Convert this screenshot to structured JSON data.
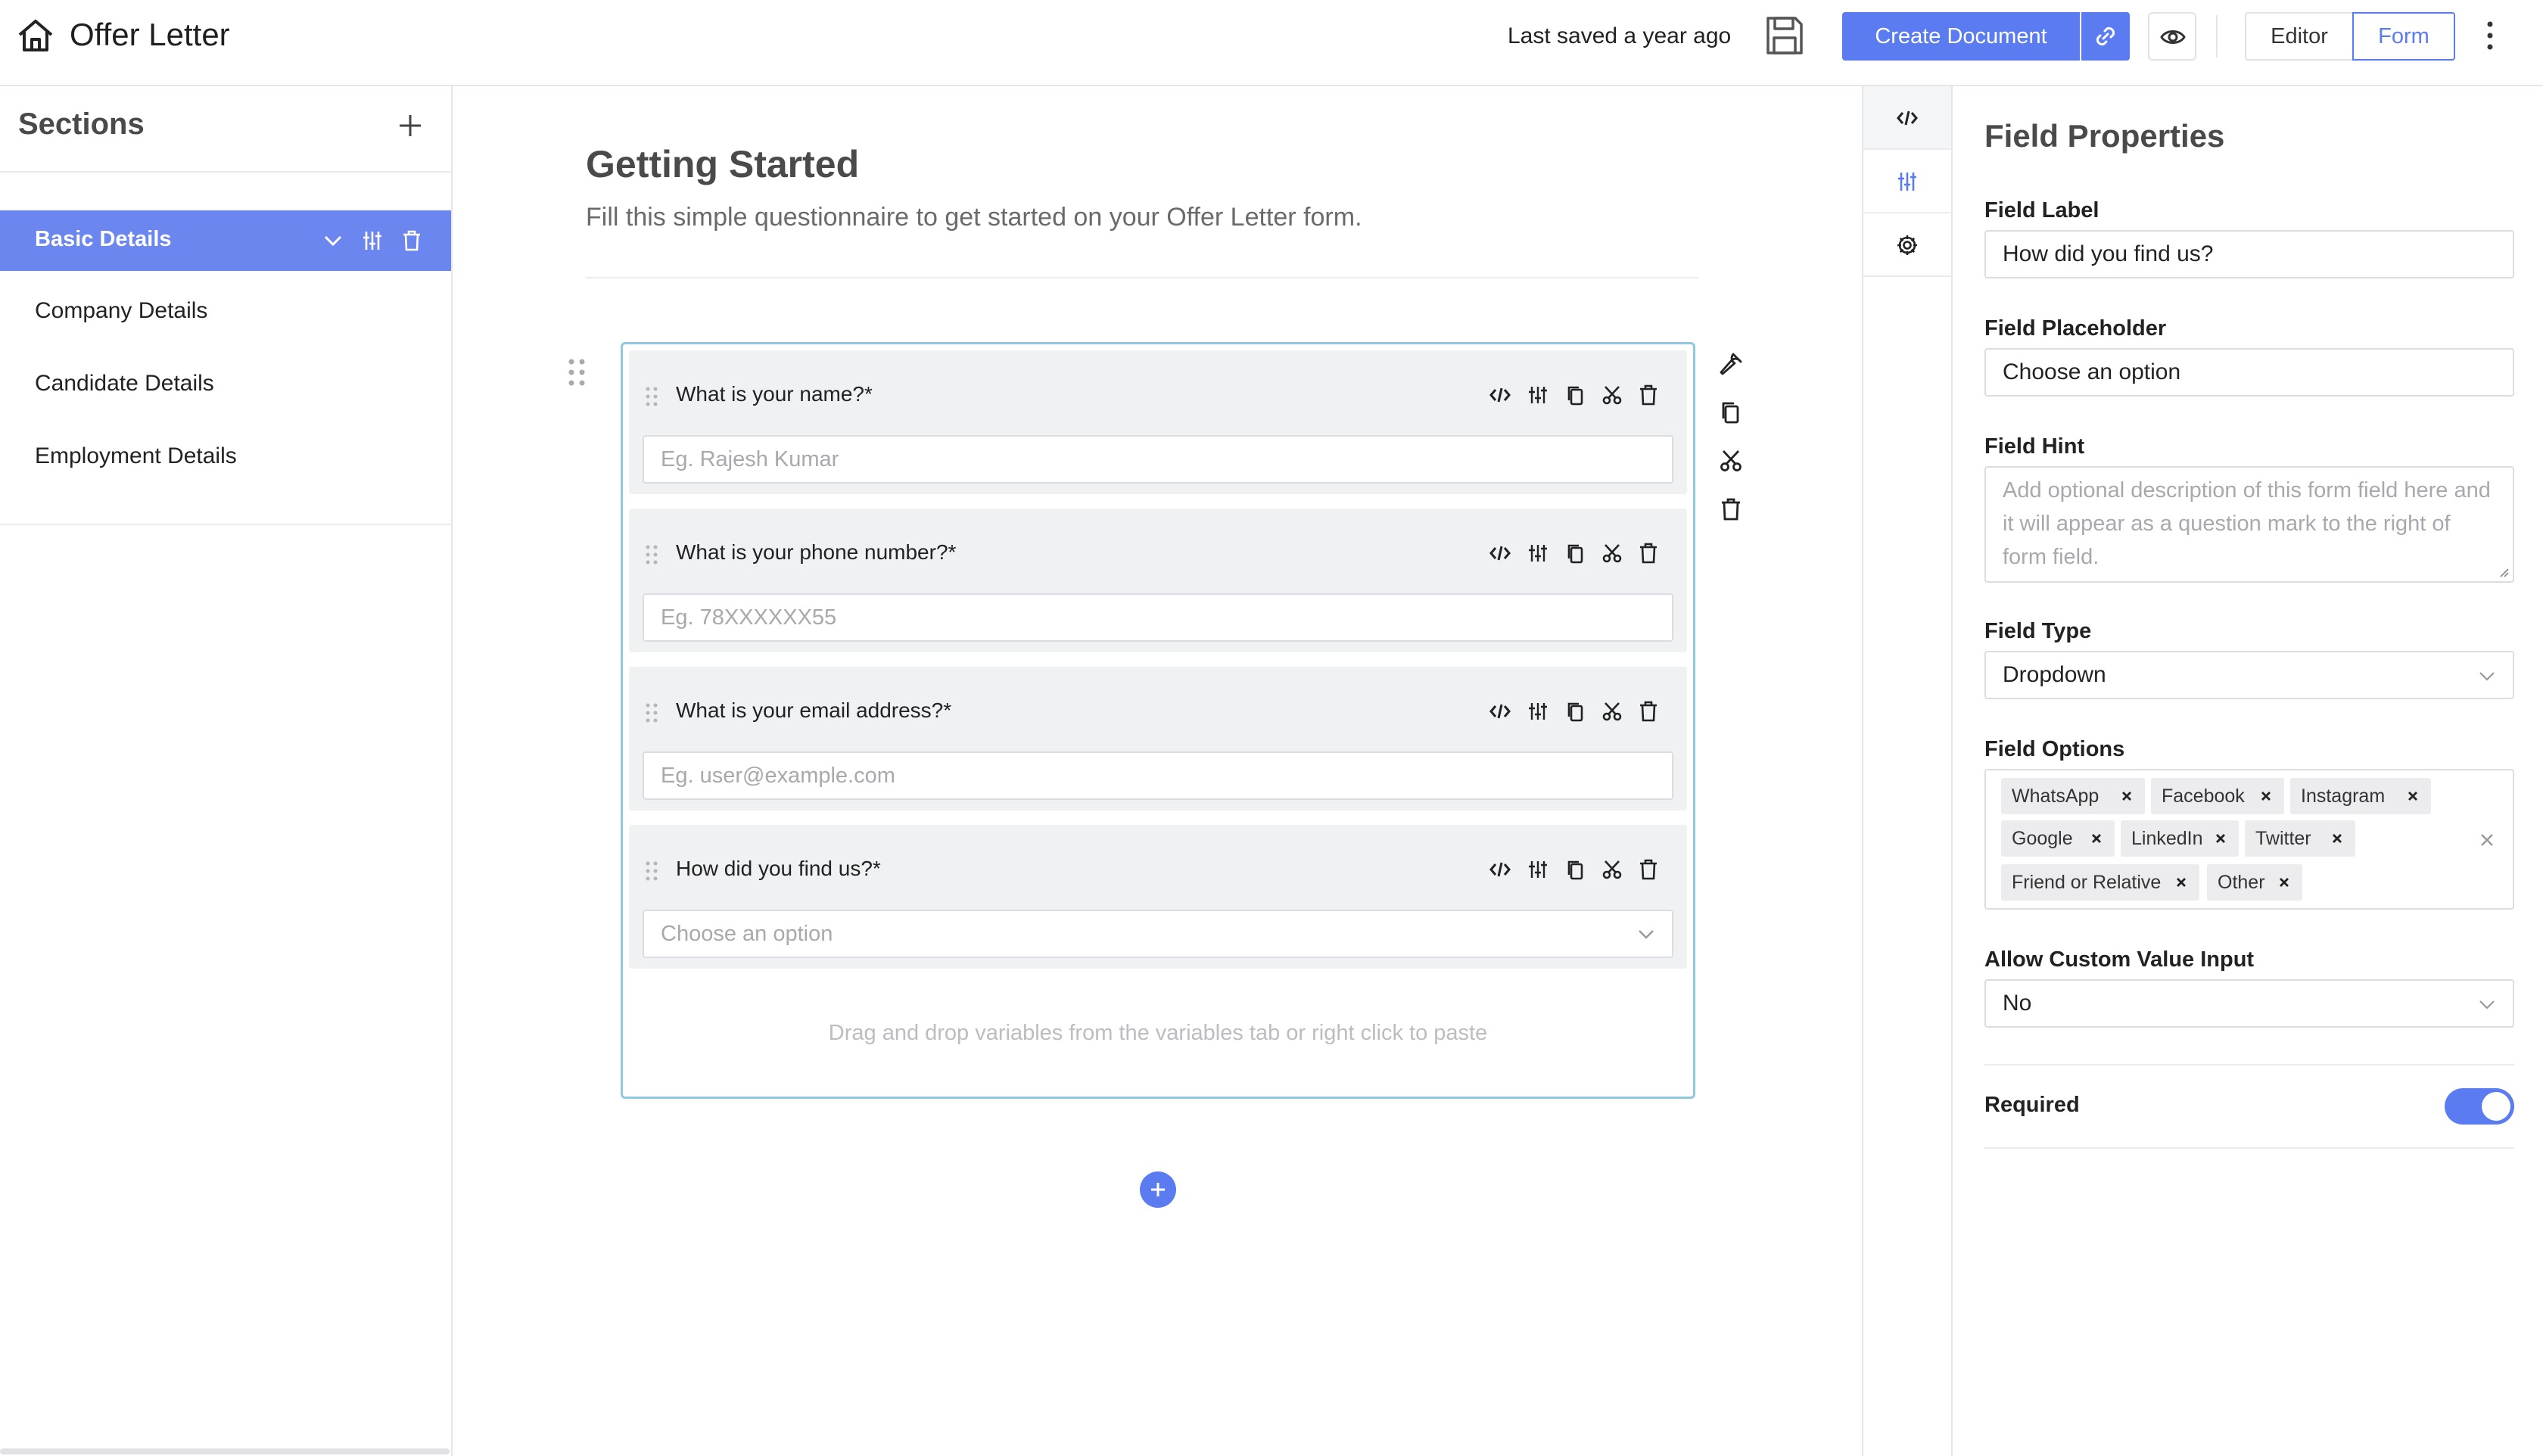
{
  "header": {
    "doc_title": "Offer Letter",
    "last_saved": "Last saved a year ago",
    "create_button": "Create Document",
    "mode_editor": "Editor",
    "mode_form": "Form",
    "accent_color": "#5a7cf0"
  },
  "sidebar": {
    "title": "Sections",
    "items": [
      {
        "label": "Basic Details",
        "active": true
      },
      {
        "label": "Company Details"
      },
      {
        "label": "Candidate Details"
      },
      {
        "label": "Employment Details"
      }
    ]
  },
  "main": {
    "title": "Getting Started",
    "subtitle": "Fill this simple questionnaire to get started on your Offer Letter form.",
    "fields": [
      {
        "label": "What is your name?*",
        "placeholder": "Eg. Rajesh Kumar",
        "type": "text"
      },
      {
        "label": "What is your phone number?*",
        "placeholder": "Eg. 78XXXXXX55",
        "type": "text"
      },
      {
        "label": "What is your email address?*",
        "placeholder": "Eg. user@example.com",
        "type": "text"
      },
      {
        "label": "How did you find us?*",
        "placeholder": "Choose an option",
        "type": "dropdown"
      }
    ],
    "drop_hint": "Drag and drop variables from the variables tab or right click to paste"
  },
  "properties": {
    "title": "Field Properties",
    "field_label_title": "Field Label",
    "field_label_value": "How did you find us?",
    "field_placeholder_title": "Field Placeholder",
    "field_placeholder_value": "Choose an option",
    "field_hint_title": "Field Hint",
    "field_hint_placeholder": "Add optional description of this form field here and it will appear as a question mark to the right of form field.",
    "field_type_title": "Field Type",
    "field_type_value": "Dropdown",
    "field_options_title": "Field Options",
    "options": [
      "WhatsApp",
      "Facebook",
      "Instagram",
      "Google",
      "LinkedIn",
      "Twitter",
      "Friend or Relative",
      "Other"
    ],
    "custom_input_title": "Allow Custom Value Input",
    "custom_input_value": "No",
    "required_title": "Required",
    "required_on": true
  }
}
